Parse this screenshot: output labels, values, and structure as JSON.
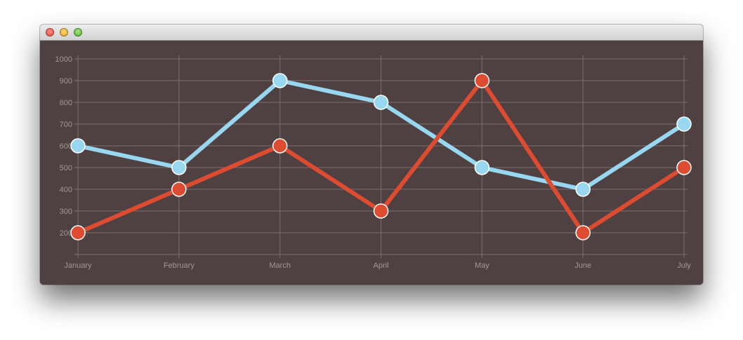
{
  "window": {
    "title": ""
  },
  "colors": {
    "background": "#4f4142",
    "grid": "#7d6f70",
    "tick_label": "#a39697",
    "series_1": "#97d8f0",
    "series_2": "#dd4b30"
  },
  "chart_data": {
    "type": "line",
    "title": "",
    "xlabel": "",
    "ylabel": "",
    "categories": [
      "January",
      "February",
      "March",
      "April",
      "May",
      "June",
      "July"
    ],
    "y_ticks": [
      "200",
      "300",
      "400",
      "500",
      "600",
      "700",
      "800",
      "900",
      "1000"
    ],
    "ylim": [
      100,
      1000
    ],
    "grid": true,
    "legend": "none",
    "series": [
      {
        "values": [
          600,
          500,
          900,
          800,
          500,
          400,
          700
        ],
        "color": "#97d8f0"
      },
      {
        "values": [
          200,
          400,
          600,
          300,
          900,
          200,
          500
        ],
        "color": "#dd4b30"
      }
    ]
  }
}
